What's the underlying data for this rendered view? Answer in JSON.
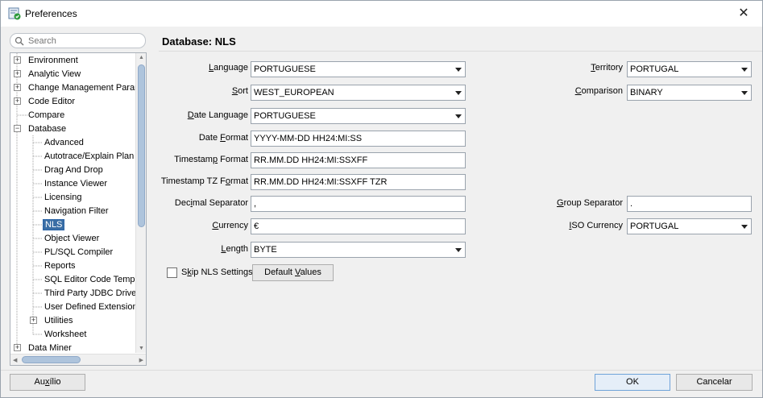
{
  "window": {
    "title": "Preferences",
    "close_symbol": "✕"
  },
  "search": {
    "placeholder": "Search",
    "value": ""
  },
  "tree": {
    "items": [
      {
        "label": "Environment",
        "expander": "+"
      },
      {
        "label": "Analytic View",
        "expander": "+"
      },
      {
        "label": "Change Management Paran",
        "expander": "+"
      },
      {
        "label": "Code Editor",
        "expander": "+"
      },
      {
        "label": "Compare",
        "expander": ""
      },
      {
        "label": "Database",
        "expander": "−"
      },
      {
        "label": "Advanced",
        "expander": ""
      },
      {
        "label": "Autotrace/Explain Plan",
        "expander": ""
      },
      {
        "label": "Drag And Drop",
        "expander": ""
      },
      {
        "label": "Instance Viewer",
        "expander": ""
      },
      {
        "label": "Licensing",
        "expander": ""
      },
      {
        "label": "Navigation Filter",
        "expander": ""
      },
      {
        "label": "NLS",
        "expander": "",
        "selected": true
      },
      {
        "label": "Object Viewer",
        "expander": ""
      },
      {
        "label": "PL/SQL Compiler",
        "expander": ""
      },
      {
        "label": "Reports",
        "expander": ""
      },
      {
        "label": "SQL Editor Code Templa",
        "expander": ""
      },
      {
        "label": "Third Party JDBC Drivei",
        "expander": ""
      },
      {
        "label": "User Defined Extension",
        "expander": ""
      },
      {
        "label": "Utilities",
        "expander": "+"
      },
      {
        "label": "Worksheet",
        "expander": ""
      },
      {
        "label": "Data Miner",
        "expander": "+"
      }
    ]
  },
  "panel": {
    "title": "Database: NLS",
    "language": {
      "label_pre": "",
      "label_u": "L",
      "label_post": "anguage",
      "value": "PORTUGUESE"
    },
    "sort": {
      "label_pre": "",
      "label_u": "S",
      "label_post": "ort",
      "value": "WEST_EUROPEAN"
    },
    "date_language": {
      "label_pre": "",
      "label_u": "D",
      "label_post": "ate Language",
      "value": "PORTUGUESE"
    },
    "date_format": {
      "label_pre": "Date ",
      "label_u": "F",
      "label_post": "ormat",
      "value": "YYYY-MM-DD HH24:MI:SS"
    },
    "timestamp_format": {
      "label_pre": "Timestam",
      "label_u": "p",
      "label_post": " Format",
      "value": "RR.MM.DD HH24:MI:SSXFF"
    },
    "timestamp_tz_format": {
      "label_pre": "Timestamp TZ F",
      "label_u": "o",
      "label_post": "rmat",
      "value": "RR.MM.DD HH24:MI:SSXFF TZR"
    },
    "decimal_separator": {
      "label_pre": "Dec",
      "label_u": "i",
      "label_post": "mal Separator",
      "value": ","
    },
    "currency": {
      "label_pre": "",
      "label_u": "C",
      "label_post": "urrency",
      "value": "€"
    },
    "length": {
      "label_pre": "",
      "label_u": "L",
      "label_post": "ength",
      "value": "BYTE"
    },
    "territory": {
      "label_pre": "",
      "label_u": "T",
      "label_post": "erritory",
      "value": "PORTUGAL"
    },
    "comparison": {
      "label_pre": "",
      "label_u": "C",
      "label_post": "omparison",
      "value": "BINARY"
    },
    "group_separator": {
      "label_pre": "",
      "label_u": "G",
      "label_post": "roup Separator",
      "value": "."
    },
    "iso_currency": {
      "label_pre": "",
      "label_u": "I",
      "label_post": "SO Currency",
      "value": "PORTUGAL"
    },
    "skip_nls": {
      "label_pre": "S",
      "label_u": "k",
      "label_post": "ip NLS Settings",
      "checked": false
    },
    "default_values": {
      "label_pre": "Default ",
      "label_u": "V",
      "label_post": "alues"
    }
  },
  "footer": {
    "help": {
      "label_pre": "Au",
      "label_u": "x",
      "label_post": "ílio"
    },
    "ok": "OK",
    "cancel": "Cancelar"
  },
  "colors": {
    "selection": "#3a6ea5",
    "scroll_thumb": "#aec4dc",
    "primary_border": "#6fa3d9"
  },
  "icons": {
    "app": "preferences-icon",
    "search": "search-icon"
  }
}
